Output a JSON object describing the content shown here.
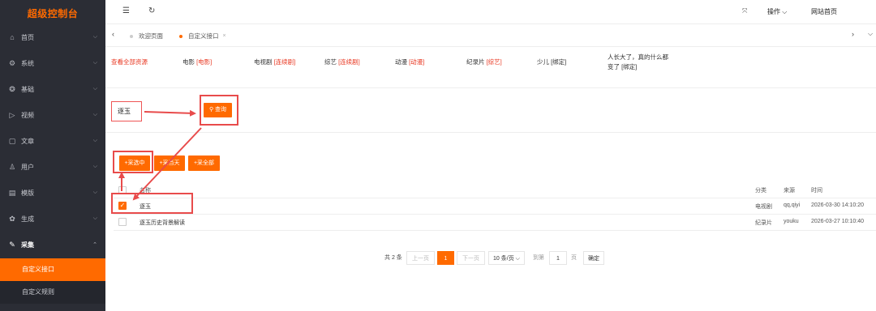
{
  "sidebar": {
    "logo": "超级控制台",
    "items": [
      {
        "icon": "home-icon",
        "glyph": "⌂",
        "label": "首页"
      },
      {
        "icon": "system-icon",
        "glyph": "⚙",
        "label": "系统"
      },
      {
        "icon": "basic-icon",
        "glyph": "❂",
        "label": "基础"
      },
      {
        "icon": "video-icon",
        "glyph": "▷",
        "label": "视频"
      },
      {
        "icon": "article-icon",
        "glyph": "▢",
        "label": "文章"
      },
      {
        "icon": "user-icon",
        "glyph": "♙",
        "label": "用户"
      },
      {
        "icon": "template-icon",
        "glyph": "▤",
        "label": "模版"
      },
      {
        "icon": "generate-icon",
        "glyph": "✿",
        "label": "生成"
      },
      {
        "icon": "collect-icon",
        "glyph": "✎",
        "label": "采集"
      }
    ],
    "sub_items": [
      {
        "label": "自定义接口"
      },
      {
        "label": "自定义规则"
      }
    ]
  },
  "topbar": {
    "operate_label": "操作",
    "site_home_label": "网站首页"
  },
  "tabs": [
    {
      "label": "欢迎页面"
    },
    {
      "label": "自定义接口"
    }
  ],
  "resources": {
    "all_label": "查看全部资源",
    "items": [
      {
        "name": "电影",
        "bind": "[电影]"
      },
      {
        "name": "电视剧",
        "bind": "[连续剧]"
      },
      {
        "name": "综艺",
        "bind": "[连续剧]"
      },
      {
        "name": "动漫",
        "bind": "[动漫]"
      },
      {
        "name": "纪录片",
        "bind": "[综艺]"
      },
      {
        "name": "少儿",
        "bind": "[绑定]"
      }
    ],
    "last_line1": "人长大了，真的什么都",
    "last_line2": "变了 [绑定]"
  },
  "search": {
    "value": "逐玉",
    "button": "查询"
  },
  "actions": {
    "collect_selected": "+采选中",
    "collect_today": "+采当天",
    "collect_all": "+采全部"
  },
  "table": {
    "headers": {
      "name": "名称",
      "category": "分类",
      "source": "来源",
      "time": "时间"
    },
    "rows": [
      {
        "checked": true,
        "name": "逐玉",
        "category": "电视剧",
        "source": "qq,qiyi",
        "time": "2026-03-30 14:10:20"
      },
      {
        "checked": false,
        "name": "逐玉历史背景解读",
        "category": "纪录片",
        "source": "youku",
        "time": "2026-03-27 10:10:40"
      }
    ]
  },
  "pagination": {
    "total": "共 2 条",
    "prev": "上一页",
    "current": "1",
    "next": "下一页",
    "per_page": "10 条/页",
    "goto": "到第",
    "goto_value": "1",
    "page_unit": "页",
    "confirm": "确定"
  },
  "colors": {
    "accent": "#ff6a00",
    "sidebar": "#2b2d35",
    "highlight": "#e84b4b"
  }
}
